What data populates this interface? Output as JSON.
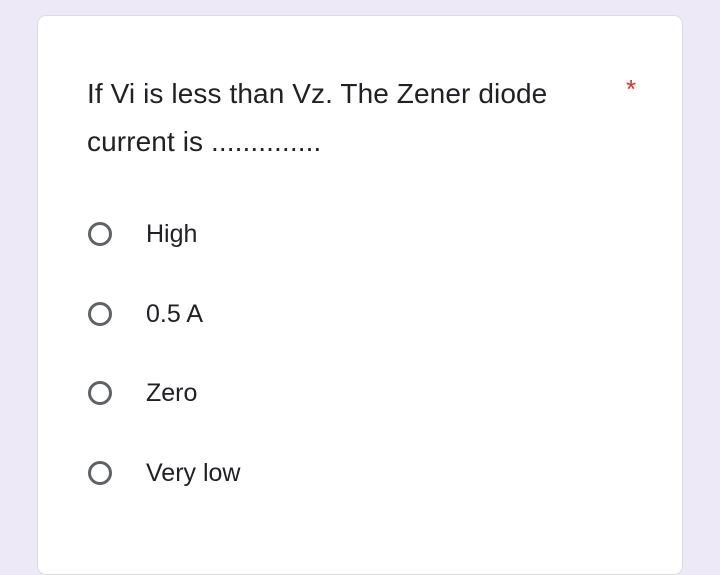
{
  "question": {
    "line1": "If Vi is less than Vz. The Zener diode",
    "line2": "current is ..............",
    "required_marker": "*"
  },
  "colors": {
    "background": "#ede9f6",
    "card": "#ffffff",
    "text": "#202124",
    "required": "#d93025",
    "radio_border": "#5f6368"
  },
  "options": [
    {
      "label": "High",
      "selected": false
    },
    {
      "label": "0.5 A",
      "selected": false
    },
    {
      "label": "Zero",
      "selected": false
    },
    {
      "label": "Very low",
      "selected": false
    }
  ]
}
